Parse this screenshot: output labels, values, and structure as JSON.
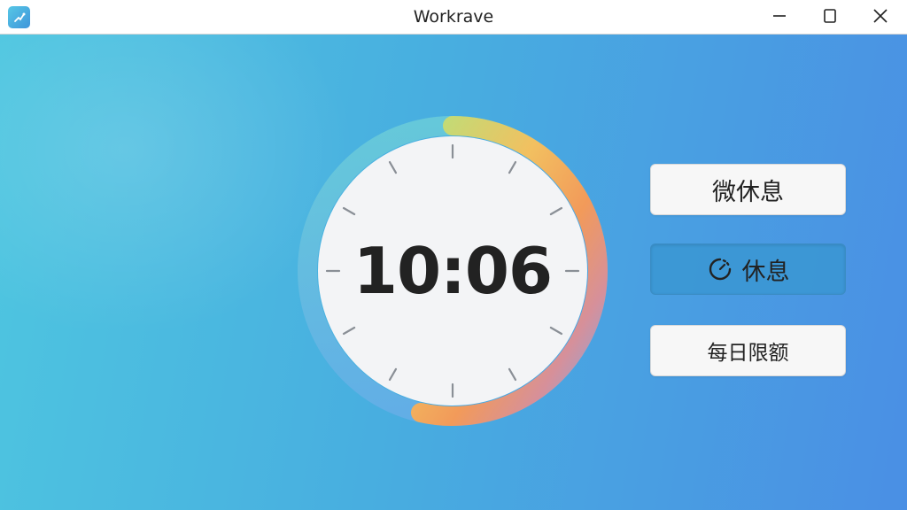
{
  "window": {
    "title": "Workrave",
    "controls": {
      "minimize_icon": "minimize-icon",
      "maximize_icon": "maximize-icon",
      "close_icon": "close-icon"
    }
  },
  "timer": {
    "display": "10:06",
    "ring_colors": [
      "#b9e07a",
      "#f2c060",
      "#f29a5a",
      "#e8907a",
      "#9fb8e8",
      "#6fa8e8",
      "#66c6dc"
    ]
  },
  "buttons": {
    "micro_break": "微休息",
    "rest_break": "休息",
    "daily_limit": "每日限额"
  },
  "theme": {
    "background_gradient": [
      "#4ec6e0",
      "#48aee0",
      "#4a8fe4"
    ],
    "active_button": "#3a96d2"
  }
}
